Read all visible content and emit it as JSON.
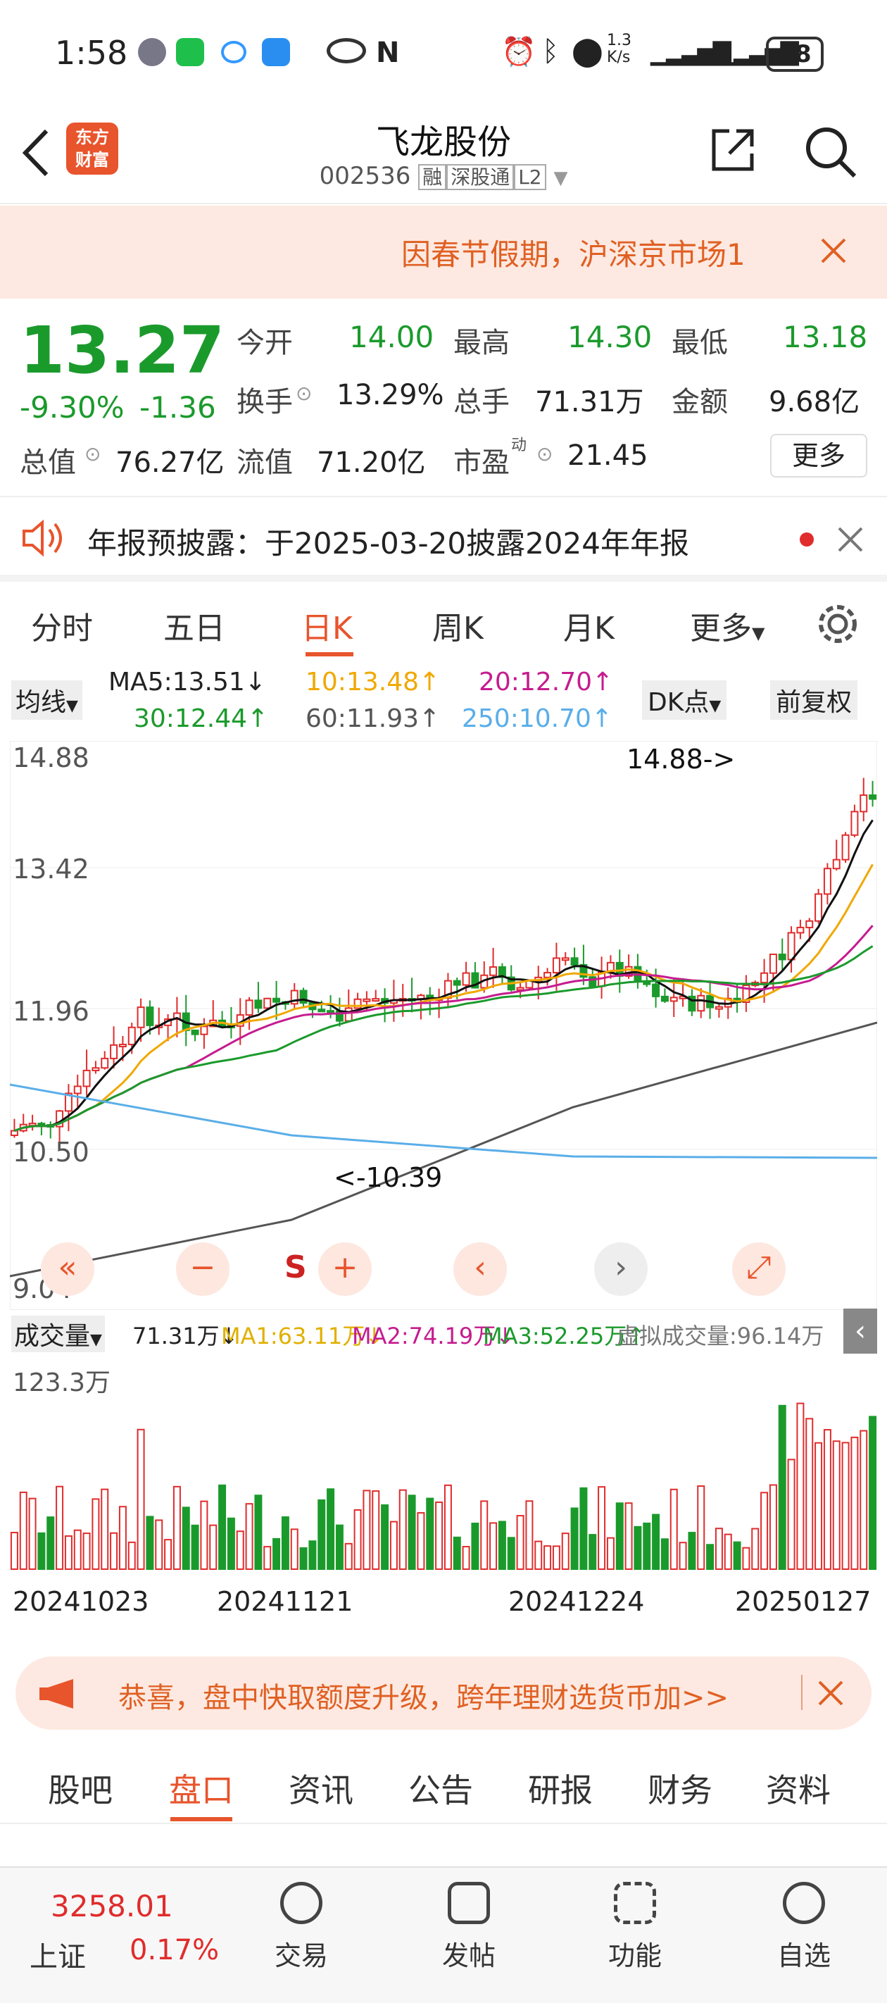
{
  "status": {
    "time": "1:58",
    "speed": "1.3\nK/s",
    "battery": "88"
  },
  "header": {
    "title": "飞龙股份",
    "code": "002536",
    "tags": [
      "融",
      "深股通",
      "L2"
    ],
    "logo": "东方\n财富"
  },
  "notice": {
    "text": "因春节假期，沪深京市场1"
  },
  "quote": {
    "price": "13.27",
    "pct": "-9.30%",
    "chg": "-1.36",
    "open_l": "今开",
    "open": "14.00",
    "high_l": "最高",
    "high": "14.30",
    "low_l": "最低",
    "low": "13.18",
    "turn_l": "换手",
    "turn": "13.29%",
    "vol_l": "总手",
    "vol": "71.31万",
    "amt_l": "金额",
    "amt": "9.68亿",
    "mcap_l": "总值",
    "mcap": "76.27亿",
    "fcap_l": "流值",
    "fcap": "71.20亿",
    "pe_l": "市盈",
    "pe_sup": "动",
    "pe": "21.45",
    "more": "更多"
  },
  "announce": {
    "text": "年报预披露：于2025-03-20披露2024年年报"
  },
  "tabs": [
    "分时",
    "五日",
    "日K",
    "周K",
    "月K",
    "更多"
  ],
  "ma": {
    "sel": "均线",
    "ma5": "MA5:13.51↓",
    "ma10": "10:13.48↑",
    "ma20": "20:12.70↑",
    "ma30": "30:12.44↑",
    "ma60": "60:11.93↑",
    "ma250": "250:10.70↑",
    "dk": "DK点",
    "fq": "前复权"
  },
  "chart": {
    "y_max": "14.88",
    "y_2": "13.42",
    "y_3": "11.96",
    "y_4": "10.50",
    "y_min": "9.04",
    "hi_label": "14.88->",
    "lo_label": "<-10.39",
    "s_mark": "S"
  },
  "volume": {
    "sel": "成交量",
    "v": "71.31万↓",
    "ma1": "MA1:63.11万↓",
    "ma2": "MA2:74.19万↓",
    "ma3": "MA3:52.25万↑",
    "virtual": "虚拟成交量:96.14万",
    "max": "123.3万"
  },
  "dates": [
    "20241023",
    "20241121",
    "20241224",
    "20250127"
  ],
  "promo": {
    "text": "恭喜，盘中快取额度升级，跨年理财选货币加>>"
  },
  "bottom_tabs": [
    "股吧",
    "盘口",
    "资讯",
    "公告",
    "研报",
    "财务",
    "资料"
  ],
  "index": {
    "value": "3258.01",
    "name": "上证",
    "pct": "0.17%"
  },
  "nav": [
    "交易",
    "发帖",
    "功能",
    "自选"
  ],
  "colors": {
    "up": "#e02c2c",
    "down": "#1b9a2c",
    "accent": "#e8542c"
  }
}
